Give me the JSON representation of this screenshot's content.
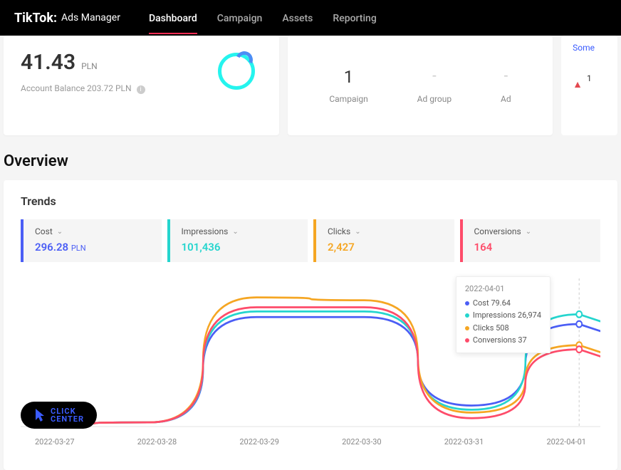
{
  "header": {
    "logo_main": "TikTok:",
    "logo_sub": "Ads Manager",
    "nav": [
      "Dashboard",
      "Campaign",
      "Assets",
      "Reporting"
    ],
    "active_nav_index": 0
  },
  "balance_card": {
    "amount": "41.43",
    "currency": "PLN",
    "sub_text": "Account Balance 203.72 PLN"
  },
  "campaign_card": {
    "stats": [
      {
        "value": "1",
        "label": "Campaign"
      },
      {
        "value": "-",
        "label": "Ad group"
      },
      {
        "value": "-",
        "label": "Ad"
      }
    ]
  },
  "alert_card": {
    "link_text": "Some",
    "count": "1"
  },
  "overview": {
    "title": "Overview",
    "trends_title": "Trends",
    "metrics": {
      "cost": {
        "label": "Cost",
        "value": "296.28",
        "unit": "PLN"
      },
      "impressions": {
        "label": "Impressions",
        "value": "101,436"
      },
      "clicks": {
        "label": "Clicks",
        "value": "2,427"
      },
      "conversions": {
        "label": "Conversions",
        "value": "164"
      }
    }
  },
  "tooltip": {
    "date": "2022-04-01",
    "rows": [
      {
        "label": "Cost",
        "value": "79.64",
        "color": "blue"
      },
      {
        "label": "Impressions",
        "value": "26,974",
        "color": "teal"
      },
      {
        "label": "Clicks",
        "value": "508",
        "color": "orange"
      },
      {
        "label": "Conversions",
        "value": "37",
        "color": "pink"
      }
    ]
  },
  "click_badge": {
    "line1": "CLICK",
    "line2": "CENTER"
  },
  "chart_data": {
    "type": "line",
    "xlabel": "",
    "ylabel": "",
    "x": [
      "2022-03-27",
      "2022-03-28",
      "2022-03-29",
      "2022-03-30",
      "2022-03-31",
      "2022-04-01"
    ],
    "series": [
      {
        "name": "Cost",
        "color": "#4b5ef5",
        "values_norm": [
          2,
          3,
          78,
          78,
          15,
          73
        ]
      },
      {
        "name": "Impressions",
        "color": "#25d5ce",
        "values_norm": [
          2,
          3,
          82,
          82,
          12,
          80
        ]
      },
      {
        "name": "Clicks",
        "color": "#f5a623",
        "values_norm": [
          2,
          3,
          92,
          90,
          10,
          58
        ]
      },
      {
        "name": "Conversions",
        "color": "#fe4c6a",
        "values_norm": [
          2,
          3,
          85,
          85,
          6,
          55
        ]
      }
    ],
    "tooltip_point": {
      "date": "2022-04-01",
      "Cost": 79.64,
      "Impressions": 26974,
      "Clicks": 508,
      "Conversions": 37
    }
  }
}
